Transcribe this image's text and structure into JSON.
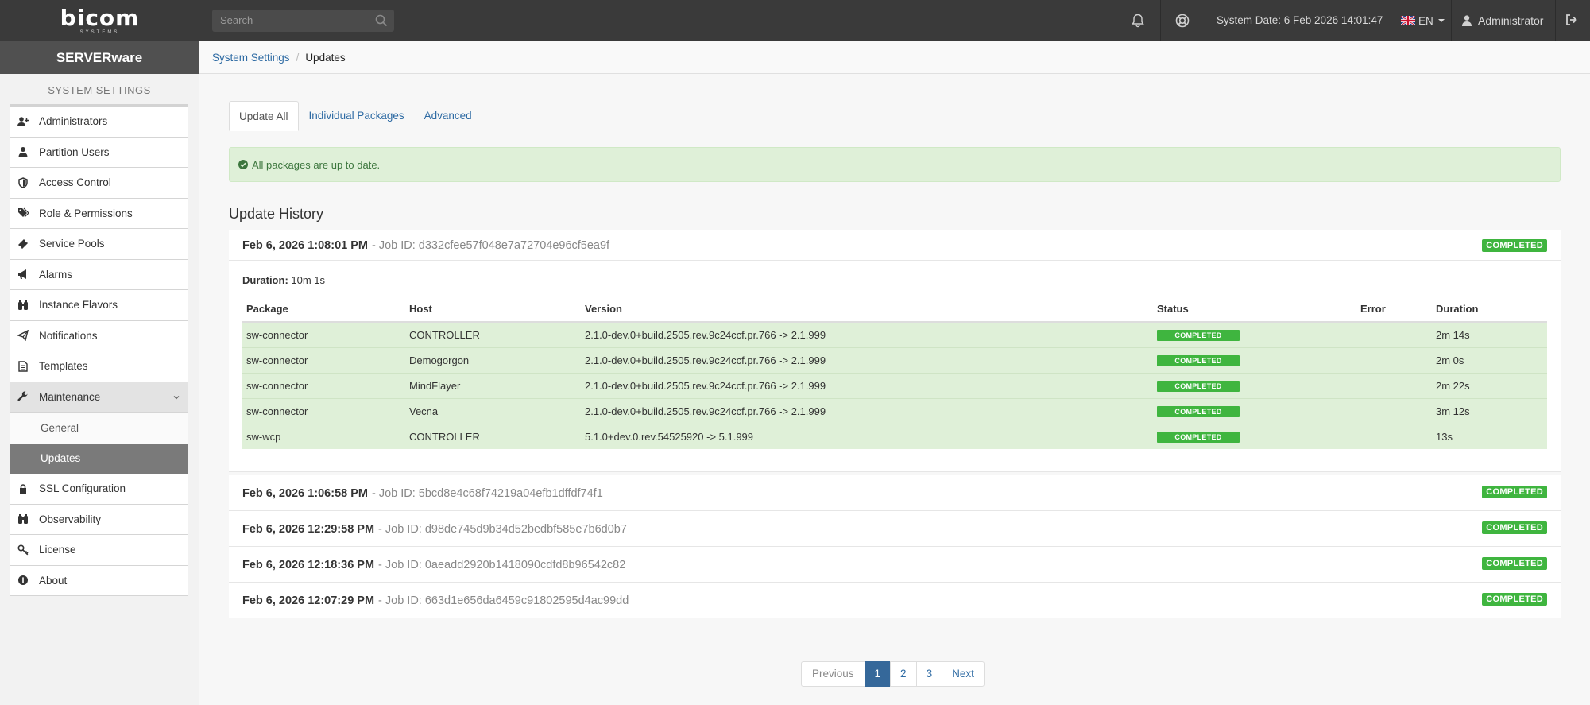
{
  "brand": {
    "logo_text": "bicom",
    "logo_sub": "SYSTEMS",
    "product": "SERVERware"
  },
  "topbar": {
    "search_placeholder": "Search",
    "system_date": "System Date: 6 Feb 2026 14:01:47",
    "language": "EN",
    "user": "Administrator"
  },
  "sidebar": {
    "section_title": "SYSTEM SETTINGS",
    "items_top": [
      {
        "label": "Administrators",
        "icon": "user-plus-icon"
      },
      {
        "label": "Partition Users",
        "icon": "user-icon"
      },
      {
        "label": "Access Control",
        "icon": "shield-icon"
      },
      {
        "label": "Role & Permissions",
        "icon": "tags-icon"
      },
      {
        "label": "Service Pools",
        "icon": "ticket-icon"
      },
      {
        "label": "Alarms",
        "icon": "bullhorn-icon"
      },
      {
        "label": "Instance Flavors",
        "icon": "binoculars-icon"
      },
      {
        "label": "Notifications",
        "icon": "paper-plane-icon"
      },
      {
        "label": "Templates",
        "icon": "file-text-icon"
      },
      {
        "label": "Maintenance",
        "icon": "wrench-icon"
      }
    ],
    "maintenance_sub": [
      {
        "label": "General"
      },
      {
        "label": "Updates"
      }
    ],
    "items_bottom": [
      {
        "label": "SSL Configuration",
        "icon": "lock-icon"
      },
      {
        "label": "Observability",
        "icon": "binoculars-icon"
      },
      {
        "label": "License",
        "icon": "key-icon"
      },
      {
        "label": "About",
        "icon": "info-circle-icon"
      }
    ]
  },
  "breadcrumb": {
    "parent": "System Settings",
    "current": "Updates"
  },
  "tabs": [
    "Update All",
    "Individual Packages",
    "Advanced"
  ],
  "alert": "All packages are up to date.",
  "history": {
    "title": "Update History",
    "expanded": {
      "date": "Feb 6, 2026 1:08:01 PM",
      "job": "- Job ID: d332cfee57f048e7a72704e96cf5ea9f",
      "status": "COMPLETED",
      "duration_label": "Duration:",
      "duration_value": "10m 1s",
      "columns": [
        "Package",
        "Host",
        "Version",
        "Status",
        "Error",
        "Duration"
      ],
      "rows": [
        {
          "package": "sw-connector",
          "host": "CONTROLLER",
          "version": "2.1.0-dev.0+build.2505.rev.9c24ccf.pr.766 -> 2.1.999",
          "status": "COMPLETED",
          "error": "",
          "duration": "2m 14s"
        },
        {
          "package": "sw-connector",
          "host": "Demogorgon",
          "version": "2.1.0-dev.0+build.2505.rev.9c24ccf.pr.766 -> 2.1.999",
          "status": "COMPLETED",
          "error": "",
          "duration": "2m 0s"
        },
        {
          "package": "sw-connector",
          "host": "MindFlayer",
          "version": "2.1.0-dev.0+build.2505.rev.9c24ccf.pr.766 -> 2.1.999",
          "status": "COMPLETED",
          "error": "",
          "duration": "2m 22s"
        },
        {
          "package": "sw-connector",
          "host": "Vecna",
          "version": "2.1.0-dev.0+build.2505.rev.9c24ccf.pr.766 -> 2.1.999",
          "status": "COMPLETED",
          "error": "",
          "duration": "3m 12s"
        },
        {
          "package": "sw-wcp",
          "host": "CONTROLLER",
          "version": "5.1.0+dev.0.rev.54525920 -> 5.1.999",
          "status": "COMPLETED",
          "error": "",
          "duration": "13s"
        }
      ]
    },
    "collapsed": [
      {
        "date": "Feb 6, 2026 1:06:58 PM",
        "job": "- Job ID: 5bcd8e4c68f74219a04efb1dffdf74f1",
        "status": "COMPLETED"
      },
      {
        "date": "Feb 6, 2026 12:29:58 PM",
        "job": "- Job ID: d98de745d9b34d52bedbf585e7b6d0b7",
        "status": "COMPLETED"
      },
      {
        "date": "Feb 6, 2026 12:18:36 PM",
        "job": "- Job ID: 0aeadd2920b1418090cdfd8b96542c82",
        "status": "COMPLETED"
      },
      {
        "date": "Feb 6, 2026 12:07:29 PM",
        "job": "- Job ID: 663d1e656da6459c91802595d4ac99dd",
        "status": "COMPLETED"
      }
    ]
  },
  "pagination": {
    "previous": "Previous",
    "pages": [
      "1",
      "2",
      "3"
    ],
    "current": "1",
    "next": "Next"
  },
  "colors": {
    "topbar": "#3a3a3a",
    "link": "#2d6aa3",
    "success_bg": "#dff0d8",
    "badge_green": "#3fb53f",
    "active_page": "#35689a"
  }
}
